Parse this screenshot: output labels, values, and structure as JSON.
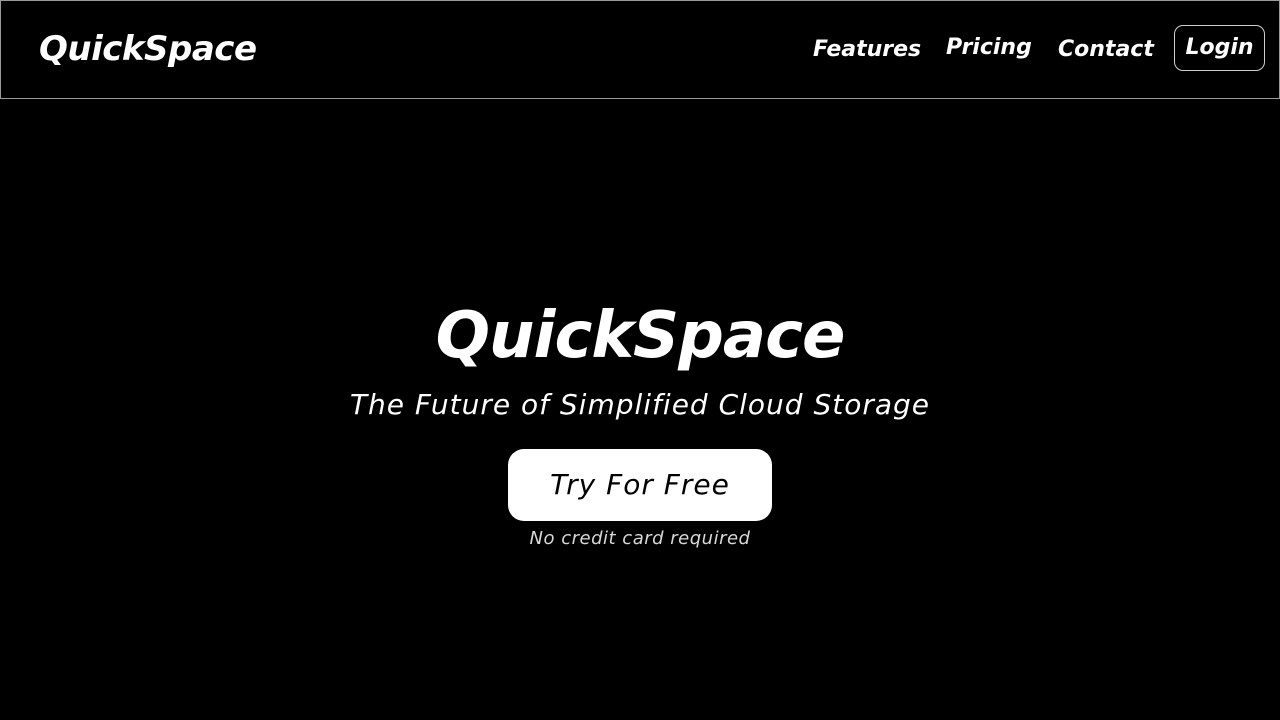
{
  "header": {
    "brand": "QuickSpace",
    "nav": {
      "features": "Features",
      "pricing": "Pricing",
      "contact": "Contact"
    },
    "login_label": "Login"
  },
  "hero": {
    "title": "QuickSpace",
    "subtitle": "The Future of Simplified Cloud Storage",
    "cta_label": "Try For Free",
    "cta_note": "No credit card required"
  },
  "colors": {
    "background": "#000000",
    "text": "#ffffff",
    "cta_background": "#ffffff",
    "cta_text": "#000000",
    "border": "#9a9a9a"
  }
}
